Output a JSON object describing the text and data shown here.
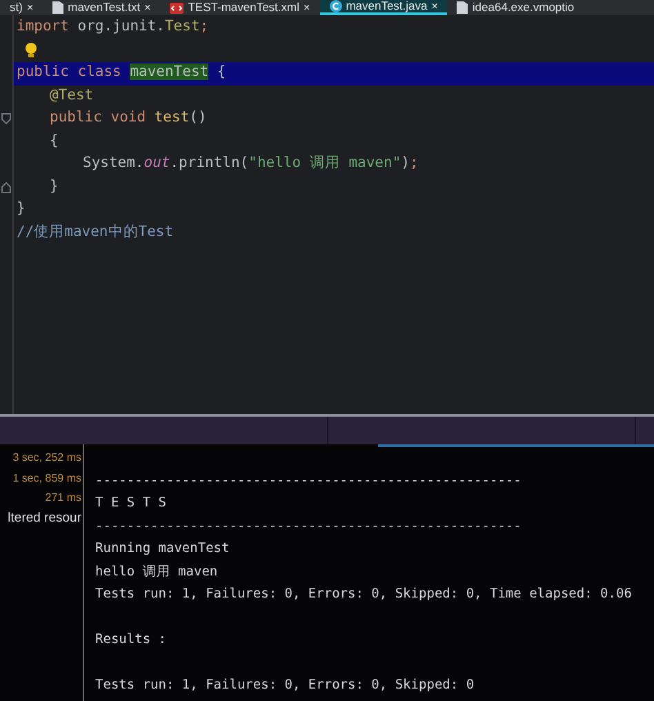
{
  "tabs": [
    {
      "label": "st)",
      "selected": false,
      "kind": "plain",
      "close": "×"
    },
    {
      "label": "mavenTest.txt",
      "selected": false,
      "kind": "file",
      "close": "×"
    },
    {
      "label": "TEST-mavenTest.xml",
      "selected": false,
      "kind": "xml",
      "close": "×"
    },
    {
      "label": "mavenTest.java",
      "selected": true,
      "kind": "class",
      "close": "×"
    },
    {
      "label": "idea64.exe.vmoptio",
      "selected": false,
      "kind": "file"
    }
  ],
  "editor": {
    "lines": [
      {
        "highlighted": false,
        "tokens": [
          {
            "kind": "keyword",
            "text": "import"
          },
          {
            "kind": "plain",
            "text": " org.junit."
          },
          {
            "kind": "annotation",
            "text": "Test"
          },
          {
            "kind": "keyword",
            "text": ";"
          }
        ]
      },
      {
        "highlighted": false,
        "bulb": true
      },
      {
        "highlighted": true,
        "tokens": [
          {
            "kind": "keyword",
            "text": "public class "
          },
          {
            "kind": "classname",
            "text": "mavenTest"
          },
          {
            "kind": "plain",
            "text": " {"
          }
        ],
        "children": [
          {
            "highlighted": false,
            "tokens": [
              {
                "kind": "annotation",
                "text": "@Test"
              }
            ]
          },
          {
            "highlighted": false,
            "fold_start": true,
            "tokens": [
              {
                "kind": "keyword",
                "text": "public void "
              },
              {
                "kind": "method",
                "text": "test"
              },
              {
                "kind": "plain",
                "text": "()"
              }
            ]
          },
          {
            "highlighted": false,
            "tokens": [
              {
                "kind": "plain",
                "text": "{"
              }
            ],
            "children": [
              {
                "highlighted": false,
                "tokens": [
                  {
                    "kind": "plain",
                    "text": "System."
                  },
                  {
                    "kind": "field",
                    "text": "out"
                  },
                  {
                    "kind": "plain",
                    "text": ".println("
                  },
                  {
                    "kind": "string",
                    "text": "\"hello 调用 maven\""
                  },
                  {
                    "kind": "plain",
                    "text": ")"
                  },
                  {
                    "kind": "keyword",
                    "text": ";"
                  }
                ]
              }
            ]
          },
          {
            "highlighted": false,
            "fold_end": true,
            "tokens": [
              {
                "kind": "plain",
                "text": "}"
              }
            ]
          }
        ]
      },
      {
        "highlighted": false,
        "tokens": [
          {
            "kind": "plain",
            "text": "}"
          }
        ]
      },
      {
        "highlighted": false,
        "tokens": [
          {
            "kind": "comment",
            "text": "//使用maven中的Test"
          }
        ]
      }
    ]
  },
  "run_panel": {
    "items": [
      {
        "text": "3 sec, 252 ms",
        "kind": "time"
      },
      {
        "text": "1 sec, 859 ms",
        "kind": "time"
      },
      {
        "text": "271 ms",
        "kind": "time"
      },
      {
        "text": "ltered resour",
        "kind": "label"
      }
    ]
  },
  "console": {
    "lines": [
      {
        "kind": "blank"
      },
      {
        "kind": "text",
        "text": "------------------------------------------------------"
      },
      {
        "kind": "text",
        "text": "T E S T S"
      },
      {
        "kind": "text",
        "text": "------------------------------------------------------"
      },
      {
        "kind": "text",
        "text": "Running mavenTest"
      },
      {
        "kind": "text",
        "text": "hello 调用 maven"
      },
      {
        "kind": "text",
        "text": "Tests run: 1, Failures: 0, Errors: 0, Skipped: 0, Time elapsed: 0.06"
      },
      {
        "kind": "blank"
      },
      {
        "kind": "text",
        "text": "Results :"
      },
      {
        "kind": "blank"
      },
      {
        "kind": "text",
        "text": "Tests run: 1, Failures: 0, Errors: 0, Skipped: 0"
      }
    ]
  }
}
